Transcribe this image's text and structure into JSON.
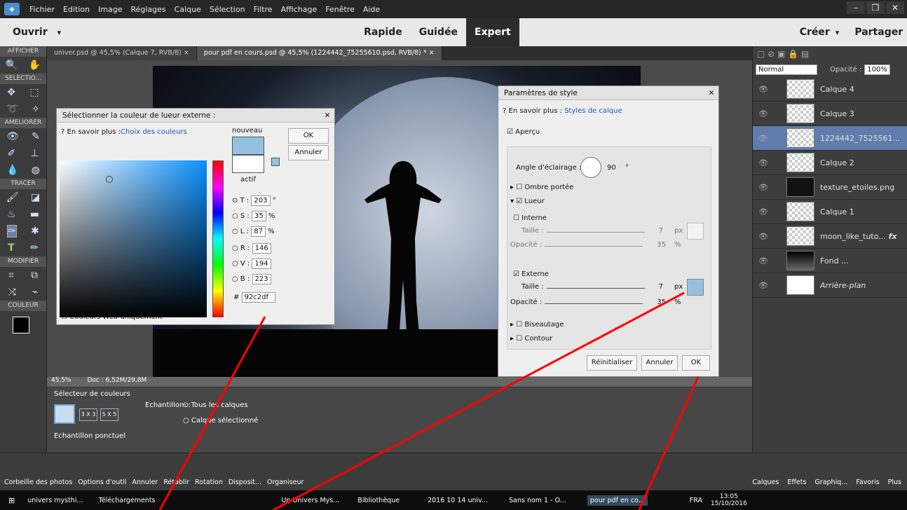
{
  "menu": {
    "items": [
      "Fichier",
      "Edition",
      "Image",
      "Réglages",
      "Calque",
      "Sélection",
      "Filtre",
      "Affichage",
      "Fenêtre",
      "Aide"
    ]
  },
  "mode": {
    "open": "Ouvrir",
    "tabs": [
      "Rapide",
      "Guidée",
      "Expert"
    ],
    "create": "Créer",
    "share": "Partager"
  },
  "tools": {
    "sections": [
      "AFFICHER",
      "SELECTIO...",
      "AMELIORER",
      "TRACER",
      "MODIFIER",
      "COULEUR"
    ]
  },
  "tabs": [
    "univer.psd @ 45,5% (Calque 7, RVB/8)",
    "pour pdf en cours.psd @ 45,5% (1224442_75255610.psd, RVB/8) *"
  ],
  "status": {
    "zoom": "45,5%",
    "doc": "Doc : 6,52M/29,8M"
  },
  "bottom": {
    "title": "Sélecteur de couleurs",
    "sample_label": "Echantillon. :",
    "sample_all": "Tous les calques",
    "sample_sel": "Calque sélectionné",
    "sample_mode": "Echantillon ponctuel",
    "sizes": [
      "3 X 3",
      "5 X 5"
    ]
  },
  "taskbar": {
    "labels": [
      "Corbeille des photos",
      "Options d'outil",
      "Annuler",
      "Rétablir",
      "Rotation",
      "Disposit...",
      "Organiseur"
    ],
    "right": [
      "Calques",
      "Effets",
      "Graphiq...",
      "Favoris",
      "Plus"
    ]
  },
  "win": {
    "items": [
      "univers mysthi...",
      "Téléchargements",
      "Un Univers Mys...",
      "Bibliothèque",
      "2016 10 14 univ...",
      "Sans nom 1 - O...",
      "pour pdf en co..."
    ],
    "lang": "FRA",
    "time": "13:05",
    "date": "15/10/2016"
  },
  "layers": {
    "blend": "Normal",
    "opacity_label": "Opacité :",
    "opacity": "100%",
    "items": [
      {
        "name": "Calque 4"
      },
      {
        "name": "Calque 3"
      },
      {
        "name": "1224442_7525561..."
      },
      {
        "name": "Calque 2"
      },
      {
        "name": "texture_etoiles.png"
      },
      {
        "name": "Calque 1"
      },
      {
        "name": "moon_like_tuto..."
      },
      {
        "name": "Fond ..."
      },
      {
        "name": "Arrière-plan"
      }
    ]
  },
  "colorpicker": {
    "title": "Sélectionner la couleur de lueur externe :",
    "learn": "En savoir plus :",
    "learn_link": "Choix des couleurs",
    "new": "nouveau",
    "current": "actif",
    "ok": "OK",
    "cancel": "Annuler",
    "T": "203",
    "S": "35",
    "L": "87",
    "R": "146",
    "V": "194",
    "B": "223",
    "hex": "92c2df",
    "web": "Couleurs Web uniquement",
    "colors": {
      "new": "#92c2df",
      "cur": "#ffffff"
    }
  },
  "style": {
    "title": "Paramètres de style",
    "learn": "En savoir plus :",
    "learn_link": "Styles de calque",
    "preview": "Aperçu",
    "angle_label": "Angle d'éclairage :",
    "angle": "90",
    "deg": "°",
    "drop": "Ombre portée",
    "glow": "Lueur",
    "inner": "Interne",
    "outer": "Externe",
    "size": "Taille :",
    "opacity": "Opacité :",
    "size_val": "7",
    "opacity_val": "35",
    "px": "px",
    "pct": "%",
    "bevel": "Biseautage",
    "contour": "Contour",
    "reset": "Réinitialiser",
    "cancel": "Annuler",
    "ok": "OK"
  }
}
